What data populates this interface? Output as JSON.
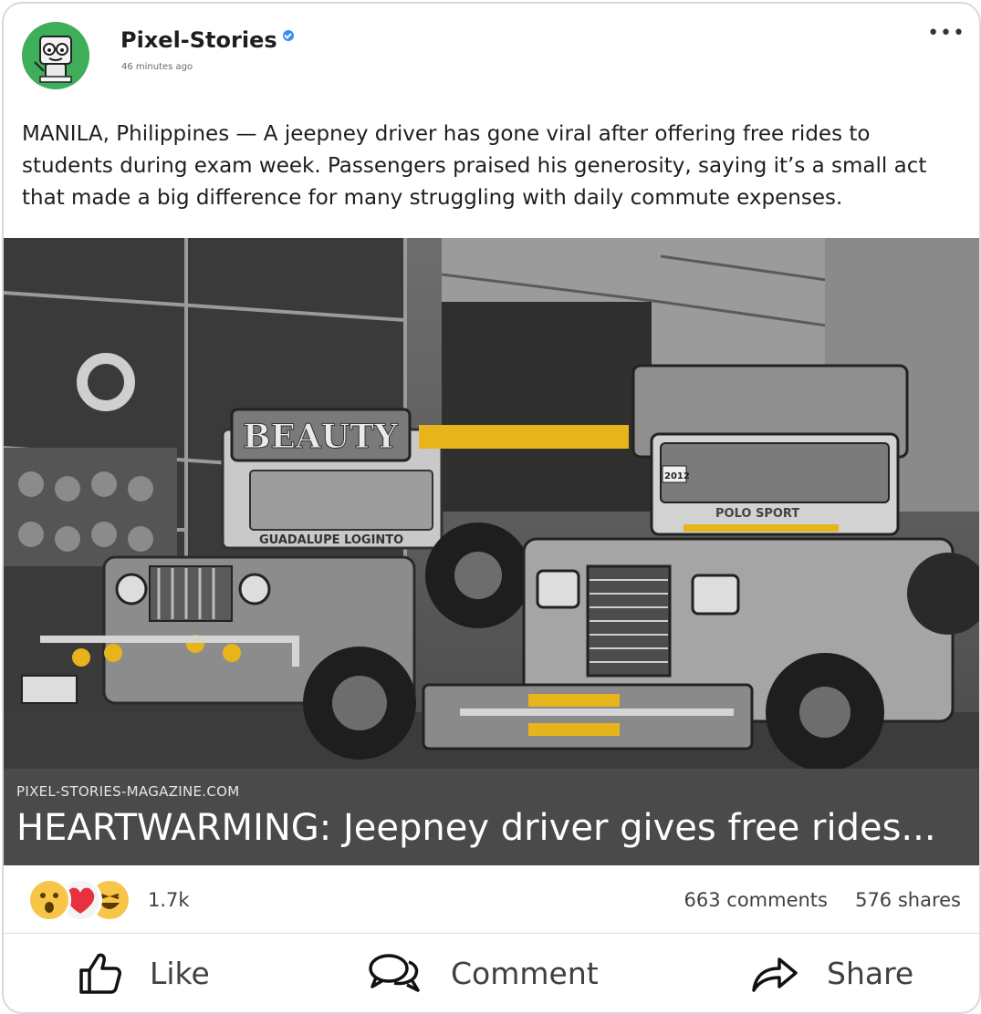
{
  "post": {
    "page_name": "Pixel-Stories",
    "timestamp": "46 minutes ago",
    "more_label": "•••",
    "text": "MANILA, Philippines — A jeepney driver has gone viral after offering free rides to students during exam week. Passengers praised his generosity, saying it’s a small act that made a big difference for many struggling with daily commute expenses."
  },
  "media": {
    "sign_text_1": "BEAUTY",
    "sign_text_2": "GUADALUPE LOGINTO",
    "sign_text_3": "POLO SPORT",
    "plate_text": "2012"
  },
  "link_preview": {
    "domain": "PIXEL-STORIES-MAGAZINE.COM",
    "headline": "HEARTWARMING: Jeepney driver gives free rides..."
  },
  "engagement": {
    "reaction_icons": [
      "wow-icon",
      "love-icon",
      "haha-icon"
    ],
    "reaction_count": "1.7k",
    "comments": "663 comments",
    "shares": "576 shares"
  },
  "actions": {
    "like": "Like",
    "comment": "Comment",
    "share": "Share"
  },
  "colors": {
    "verified": "#3b8df0",
    "avatar_bg": "#3fae5a",
    "link_bar": "#4a4a4a",
    "accent_yellow": "#e8b41c"
  }
}
